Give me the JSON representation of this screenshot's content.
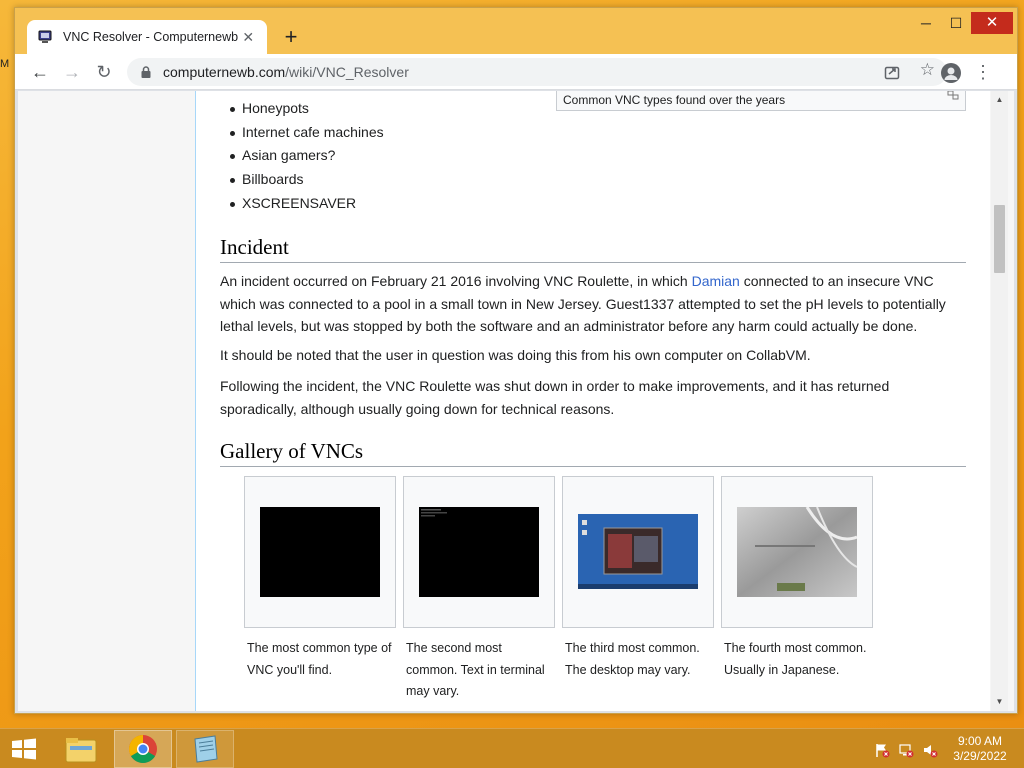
{
  "desktop": {
    "stub_text": "M"
  },
  "browser": {
    "tab": {
      "title": "VNC Resolver - Computernewb Wiki",
      "close": "✕"
    },
    "new_tab": "+",
    "window_controls": {
      "minimize": "─",
      "maximize": "☐",
      "close": "✕"
    },
    "nav": {
      "back": "←",
      "forward": "→",
      "reload": "↻"
    },
    "url": {
      "host": "computernewb.com",
      "path": "/wiki/VNC_Resolver"
    },
    "star": "☆",
    "menu": "⋮"
  },
  "page": {
    "top_caption": "Common VNC types found over the years",
    "bullets": [
      "Honeypots",
      "Internet cafe machines",
      "Asian gamers?",
      "Billboards",
      "XSCREENSAVER"
    ],
    "incident": {
      "heading": "Incident",
      "p1_before": "An incident occurred on February 21 2016 involving VNC Roulette, in which ",
      "p1_link": "Damian",
      "p1_after": " connected to an insecure VNC which was connected to a pool in a small town in New Jersey. Guest1337 attempted to set the pH levels to potentially lethal levels, but was stopped by both the software and an administrator before any harm could actually be done.",
      "p2": "It should be noted that the user in question was doing this from his own computer on CollabVM.",
      "p3": "Following the incident, the VNC Roulette was shut down in order to make improvements, and it has returned sporadically, although usually going down for technical reasons."
    },
    "gallery": {
      "heading": "Gallery of VNCs",
      "items": [
        {
          "caption": "The most common type of VNC you'll find."
        },
        {
          "caption": "The second most common. Text in terminal may vary."
        },
        {
          "caption": "The third most common. The desktop may vary."
        },
        {
          "caption": "The fourth most common. Usually in Japanese."
        }
      ]
    }
  },
  "taskbar": {
    "clock_time": "9:00 AM",
    "clock_date": "3/29/2022"
  },
  "colors": {
    "link": "#3366cc",
    "chrome_tab_strip": "#f5c153",
    "close_button": "#c42b1c"
  }
}
